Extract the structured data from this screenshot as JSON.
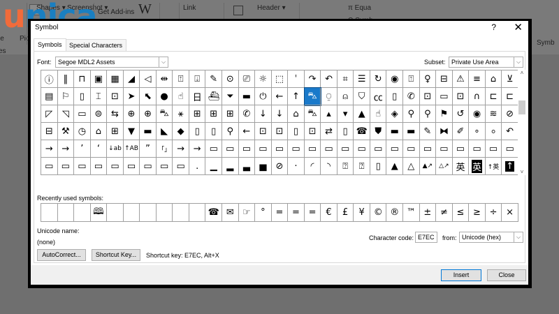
{
  "ribbon": {
    "items": [
      "Shapes ▾",
      "Screenshot ▾",
      "Get Add-ins",
      "W",
      "Link",
      "Header ▾",
      "π Equa",
      "Ω Symb",
      "Pic",
      "le",
      "es",
      "Symb"
    ]
  },
  "logo": {
    "u": "u",
    "rest": "nica"
  },
  "dialog": {
    "title": "Symbol",
    "help": "?",
    "close_glyph": "✕",
    "tabs": [
      "Symbols",
      "Special Characters"
    ],
    "font_label": "Font:",
    "font_value": "Segoe MDL2 Assets",
    "subset_label": "Subset:",
    "subset_value": "Private Use Area",
    "selected": {
      "row": 1,
      "col": 16
    },
    "grid": [
      [
        "ⓘ",
        "‖",
        "⊓",
        "▣",
        "▦",
        "◢",
        "◁",
        "⇹",
        "⍐",
        "⍗",
        "✎",
        "⊙",
        "⎚",
        "☼",
        "⬚",
        "ˈ",
        "↷",
        "↶",
        "⌗",
        "☰",
        "↻",
        "◉",
        "⍐",
        "♀",
        "⊟",
        "⚠",
        "≡",
        "⌂",
        "⊻"
      ],
      [
        "▤",
        "⚐",
        "▯",
        "⌶",
        "⊡",
        "➤",
        "⬉",
        "●",
        "☝",
        "日",
        "⛴",
        "⏷",
        "▬",
        "⏻",
        "←",
        "↑",
        "⛍",
        "⍜",
        "⍝",
        "⛉",
        "㏄",
        "▯",
        "✆",
        "⊡",
        "▭",
        "⊡",
        "∩",
        "⊏",
        "⊏"
      ],
      [
        "◸",
        "◹",
        "▭",
        "⊜",
        "⇆",
        "⊕",
        "⊕",
        "⛍",
        "⚹",
        "⊞",
        "⊞",
        "⊞",
        "✆",
        "↓",
        "↓",
        "⌂",
        "⛍",
        "▴",
        "▾",
        "▲",
        "☝",
        "◈",
        "⚲",
        "⚲",
        "⚑",
        "↺",
        "◉",
        "≋",
        "⊘"
      ],
      [
        "⊟",
        "⚒",
        "◷",
        "⌂",
        "⊞",
        "▼",
        "▬",
        "◣",
        "◆",
        "▯",
        "▯",
        "⚲",
        "←",
        "⊡",
        "⊡",
        "▯",
        "⊡",
        "⇄",
        "▯",
        "☎",
        "⛊",
        "▬",
        "▬",
        "✎",
        "⧓",
        "✐",
        "∘",
        "⸰",
        "↶"
      ],
      [
        "→",
        "→",
        "’",
        "‘",
        "↓ab",
        "↑AB",
        "”",
        "「」",
        "→",
        "→",
        "▭",
        "▭",
        "▭",
        "▭",
        "▭",
        "▭",
        "▭",
        "▭",
        "▭",
        "▭",
        "▭",
        "▭",
        "▭",
        "▭",
        "▭",
        "▭",
        "▭",
        "▭",
        "▭"
      ],
      [
        "▭",
        "▭",
        "▭",
        "▭",
        "▭",
        "▭",
        "▭",
        "▭",
        "▭",
        ".",
        "▁",
        "▂",
        "▃",
        "▅",
        "⊘",
        "·",
        "◜",
        "◝",
        "⍰",
        "⍰",
        "▯",
        "▲",
        "△",
        "▲↗",
        "△↗",
        "英",
        "英",
        "↑英",
        "↑"
      ]
    ],
    "inverted": [
      [
        5,
        26
      ],
      [
        5,
        28
      ]
    ],
    "recent_label": "Recently used symbols:",
    "recent": [
      "",
      "",
      "",
      "🕮",
      "",
      "",
      "",
      "",
      "",
      "",
      "☎",
      "✉",
      "☞",
      "°",
      "=",
      "=",
      "=",
      "€",
      "£",
      "¥",
      "©",
      "®",
      "™",
      "±",
      "≠",
      "≤",
      "≥",
      "÷",
      "×"
    ],
    "unicode_name_label": "Unicode name:",
    "unicode_name_value": "(none)",
    "char_code_label": "Character code:",
    "char_code_value": "E7EC",
    "from_label": "from:",
    "from_value": "Unicode (hex)",
    "autocorrect": "AutoCorrect...",
    "shortcut_key": "Shortcut Key...",
    "shortcut_text": "Shortcut key: E7EC, Alt+X",
    "insert": "Insert",
    "close": "Close",
    "scroll_up": "˄",
    "scroll_down": "˅"
  }
}
